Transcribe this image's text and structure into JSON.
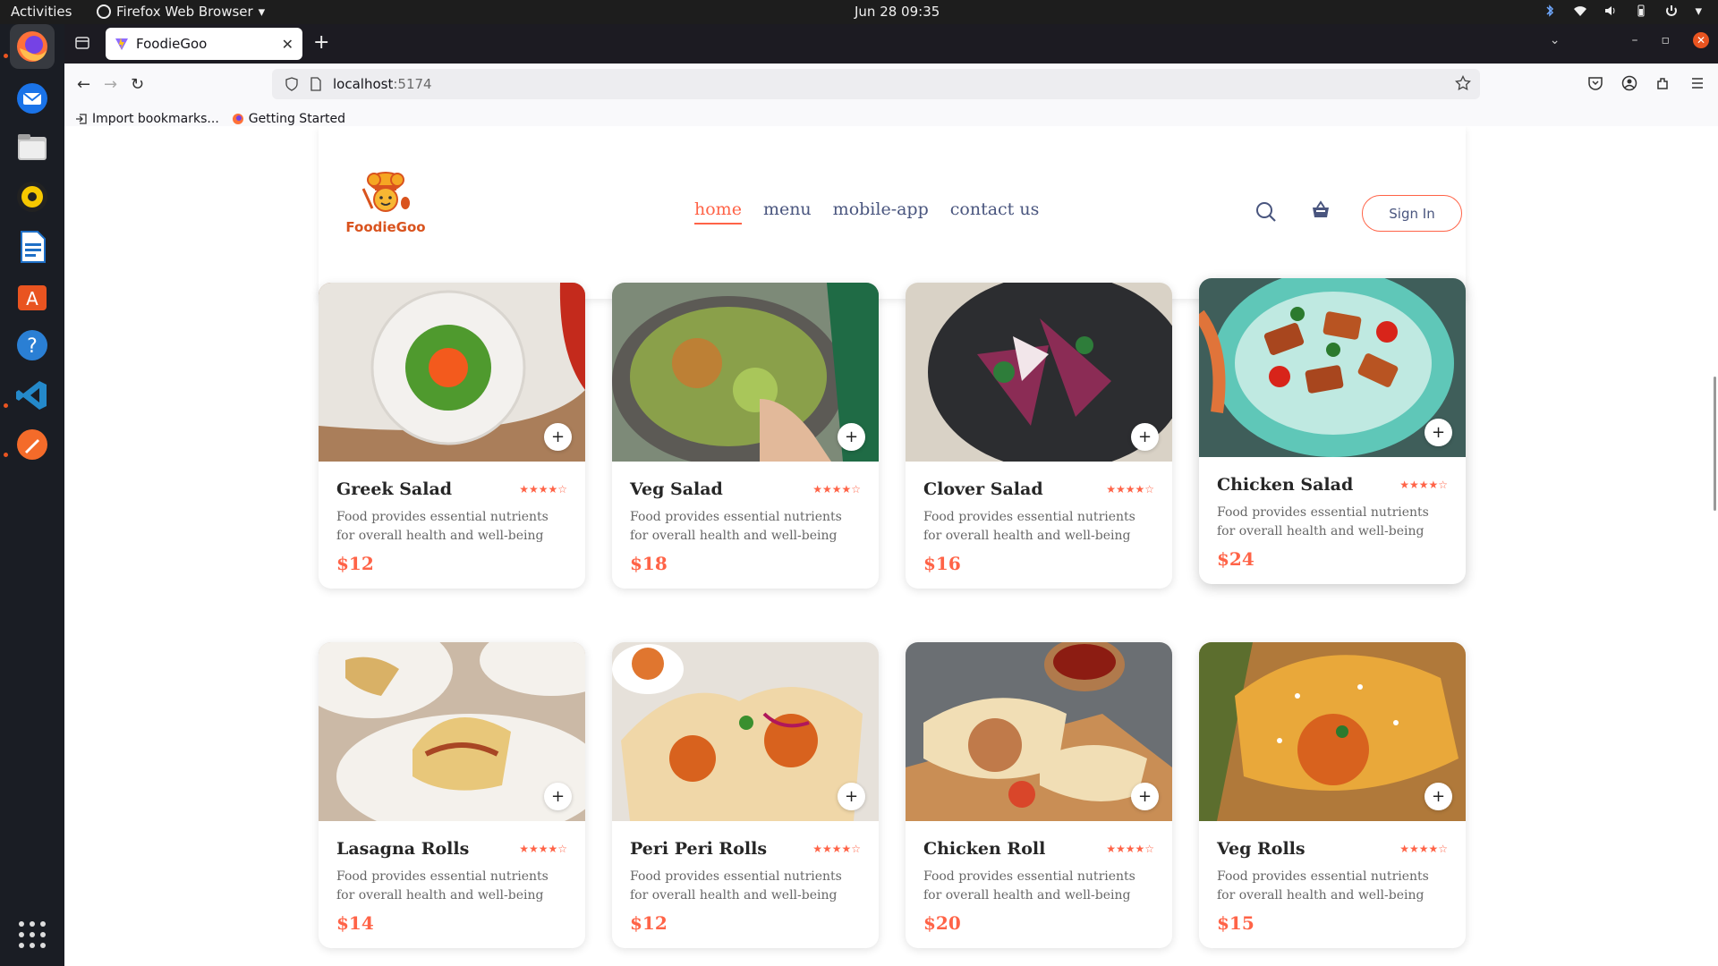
{
  "system": {
    "activities": "Activities",
    "app_menu": "Firefox Web Browser",
    "clock": "Jun 28  09:35"
  },
  "browser": {
    "tab_title": "FoodieGoo",
    "url_host": "localhost",
    "url_port": ":5174",
    "bookmarks": [
      "Import bookmarks...",
      "Getting Started"
    ]
  },
  "site": {
    "logo_text": "FoodieGoo",
    "nav": [
      "home",
      "menu",
      "mobile-app",
      "contact us"
    ],
    "signin_label": "Sign In",
    "accent_color": "#ff6347",
    "nav_color": "#49557e"
  },
  "foods": [
    {
      "name": "Greek Salad",
      "desc": "Food provides essential nutrients for overall health and well-being",
      "price": "$12",
      "rating": 4
    },
    {
      "name": "Veg Salad",
      "desc": "Food provides essential nutrients for overall health and well-being",
      "price": "$18",
      "rating": 4
    },
    {
      "name": "Clover Salad",
      "desc": "Food provides essential nutrients for overall health and well-being",
      "price": "$16",
      "rating": 4
    },
    {
      "name": "Chicken Salad",
      "desc": "Food provides essential nutrients for overall health and well-being",
      "price": "$24",
      "rating": 4
    },
    {
      "name": "Lasagna Rolls",
      "desc": "Food provides essential nutrients for overall health and well-being",
      "price": "$14",
      "rating": 4
    },
    {
      "name": "Peri Peri Rolls",
      "desc": "Food provides essential nutrients for overall health and well-being",
      "price": "$12",
      "rating": 4
    },
    {
      "name": "Chicken Roll",
      "desc": "Food provides essential nutrients for overall health and well-being",
      "price": "$20",
      "rating": 4
    },
    {
      "name": "Veg Rolls",
      "desc": "Food provides essential nutrients for overall health and well-being",
      "price": "$15",
      "rating": 4
    }
  ],
  "stars": {
    "full": "★★★★",
    "empty": "☆"
  }
}
